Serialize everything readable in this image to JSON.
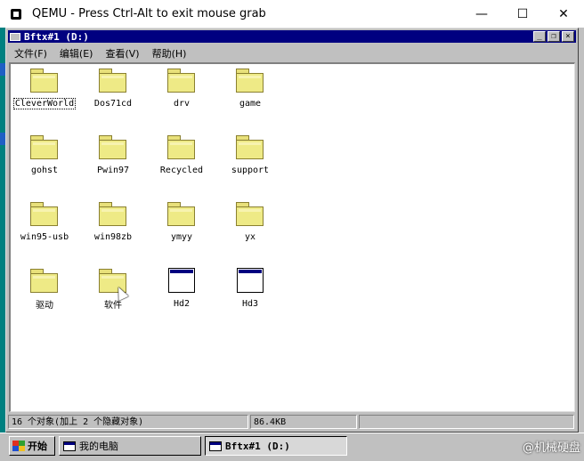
{
  "host_window": {
    "title": "QEMU - Press Ctrl-Alt to exit mouse grab",
    "minimize_glyph": "—",
    "maximize_glyph": "☐",
    "close_glyph": "✕"
  },
  "explorer": {
    "title": "Bftx#1 (D:)",
    "controls": {
      "minimize": "_",
      "restore": "❐",
      "close": "×"
    },
    "menu": [
      "文件(F)",
      "编辑(E)",
      "查看(V)",
      "帮助(H)"
    ],
    "items": [
      {
        "label": "CleverWorld",
        "type": "folder",
        "selected": true
      },
      {
        "label": "Dos71cd",
        "type": "folder"
      },
      {
        "label": "drv",
        "type": "folder"
      },
      {
        "label": "game",
        "type": "folder"
      },
      {
        "label": "gohst",
        "type": "folder"
      },
      {
        "label": "Pwin97",
        "type": "folder"
      },
      {
        "label": "Recycled",
        "type": "folder"
      },
      {
        "label": "support",
        "type": "folder"
      },
      {
        "label": "win95-usb",
        "type": "folder"
      },
      {
        "label": "win98zb",
        "type": "folder"
      },
      {
        "label": "ymyy",
        "type": "folder"
      },
      {
        "label": "yx",
        "type": "folder"
      },
      {
        "label": "驱动",
        "type": "folder"
      },
      {
        "label": "软件",
        "type": "folder"
      },
      {
        "label": "Hd2",
        "type": "window"
      },
      {
        "label": "Hd3",
        "type": "window"
      }
    ],
    "status": {
      "objects": "16 个对象(加上 2 个隐藏对象)",
      "size": "86.4KB"
    }
  },
  "taskbar": {
    "start_label": "开始",
    "tasks": [
      {
        "label": "我的电脑",
        "active": false
      },
      {
        "label": "Bftx#1 (D:)",
        "active": true
      }
    ],
    "watermark": "@机械硬盘"
  },
  "colors": {
    "win_titlebar": "#000080",
    "classic_gray": "#c0c0c0",
    "folder_yellow": "#eeea86"
  }
}
